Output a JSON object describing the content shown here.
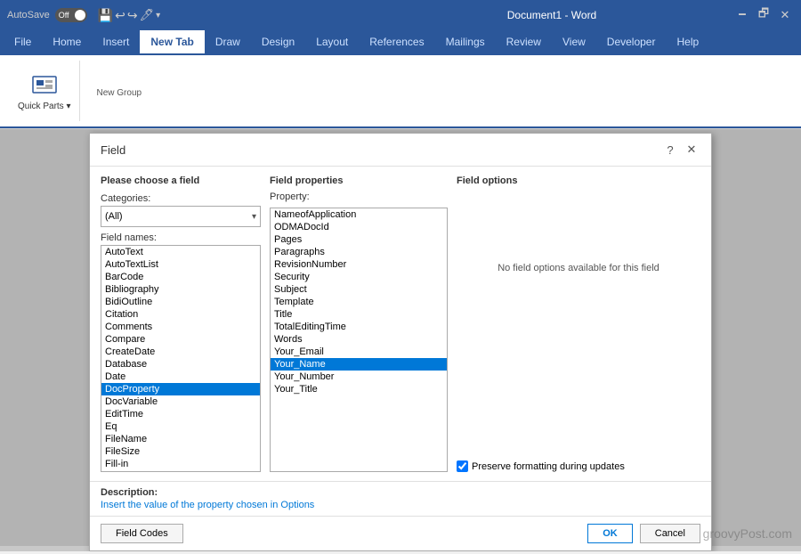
{
  "titleBar": {
    "autosave": "AutoSave",
    "autosave_state": "Off",
    "title": "Document1 - Word",
    "minimize": "🗕",
    "restore": "🗗",
    "close": "✕"
  },
  "ribbon": {
    "tabs": [
      "File",
      "Home",
      "Insert",
      "New Tab",
      "Draw",
      "Design",
      "Layout",
      "References",
      "Mailings",
      "Review",
      "View",
      "Developer",
      "Help"
    ],
    "active_tab": "New Tab",
    "quick_parts_label": "Quick Parts",
    "new_group_label": "New Group"
  },
  "dialog": {
    "title": "Field",
    "help_btn": "?",
    "close_btn": "✕",
    "choose_label": "Please choose a field",
    "categories_label": "Categories:",
    "categories_value": "(All)",
    "field_names_label": "Field names:",
    "field_list": [
      "AutoText",
      "AutoTextList",
      "BarCode",
      "Bibliography",
      "BidiOutline",
      "Citation",
      "Comments",
      "Compare",
      "CreateDate",
      "Database",
      "Date",
      "DocProperty",
      "DocVariable",
      "EditTime",
      "Eq",
      "FileName",
      "FileSize",
      "Fill-in"
    ],
    "selected_field": "DocProperty",
    "field_properties_label": "Field properties",
    "property_label": "Property:",
    "property_list": [
      "NameofApplication",
      "ODMADocId",
      "Pages",
      "Paragraphs",
      "RevisionNumber",
      "Security",
      "Subject",
      "Template",
      "Title",
      "TotalEditingTime",
      "Words",
      "Your_Email",
      "Your_Name",
      "Your_Number",
      "Your_Title"
    ],
    "selected_property": "Your_Name",
    "field_options_label": "Field options",
    "no_options_text": "No field options available for this field",
    "preserve_label": "Preserve formatting during updates",
    "description_label": "Description:",
    "description_text": "Insert the value of the property chosen in Options",
    "field_codes_btn": "Field Codes",
    "ok_btn": "OK",
    "cancel_btn": "Cancel"
  },
  "watermark": "groovyPost.com"
}
